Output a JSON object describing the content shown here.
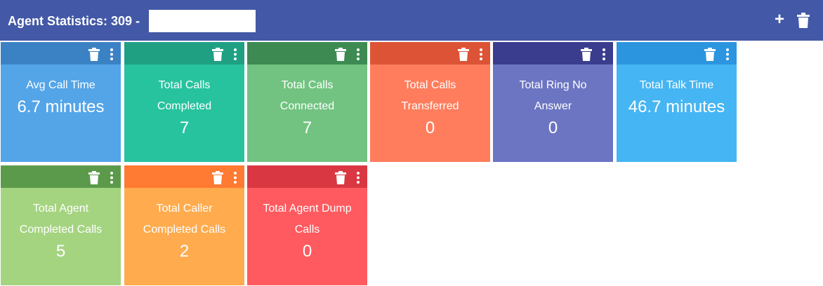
{
  "header": {
    "title": "Agent Statistics: 309 -",
    "add_icon": "+",
    "colors": {
      "background": "#4358a6"
    }
  },
  "tiles": [
    {
      "title1": "Avg Call Time",
      "title2": "",
      "value": "6.7 minutes",
      "bar_color": "#3b82c4",
      "body_color": "#54a5e8"
    },
    {
      "title1": "Total Calls",
      "title2": "Completed",
      "value": "7",
      "bar_color": "#1fa083",
      "body_color": "#27c39e"
    },
    {
      "title1": "Total Calls",
      "title2": "Connected",
      "value": "7",
      "bar_color": "#3d8a52",
      "body_color": "#72c381"
    },
    {
      "title1": "Total Calls",
      "title2": "Transferred",
      "value": "0",
      "bar_color": "#dc5435",
      "body_color": "#ff7d5c"
    },
    {
      "title1": "Total Ring No",
      "title2": "Answer",
      "value": "0",
      "bar_color": "#3a3d8e",
      "body_color": "#6c75c2"
    },
    {
      "title1": "Total Talk Time",
      "title2": "",
      "value": "46.7 minutes",
      "bar_color": "#2c95e0",
      "body_color": "#46b5f3"
    },
    {
      "title1": "Total Agent",
      "title2": "Completed Calls",
      "value": "5",
      "bar_color": "#5b9a4a",
      "body_color": "#a5d480"
    },
    {
      "title1": "Total Caller",
      "title2": "Completed Calls",
      "value": "2",
      "bar_color": "#ff7a32",
      "body_color": "#ffab4e"
    },
    {
      "title1": "Total Agent Dump",
      "title2": "Calls",
      "value": "0",
      "bar_color": "#d93842",
      "body_color": "#ff5a5f"
    }
  ],
  "icons": {
    "tile_delete": "trash-icon",
    "tile_menu": "kebab-menu-icon",
    "header_delete": "trash-icon",
    "header_add": "plus-icon"
  }
}
